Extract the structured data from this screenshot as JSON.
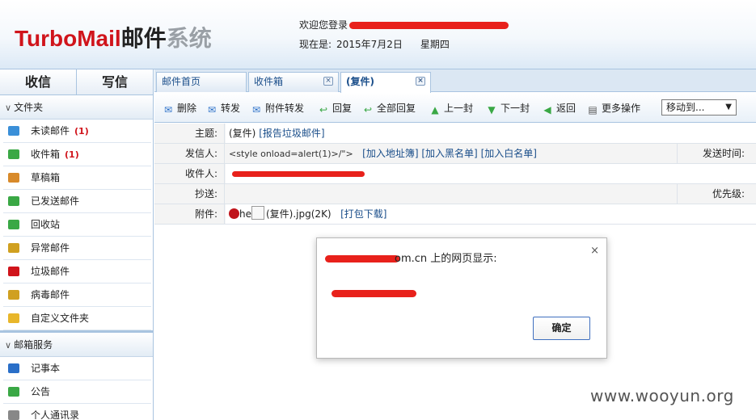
{
  "header": {
    "logo_brand": "TurboMail",
    "logo_mail": "邮件",
    "logo_system": "系统",
    "welcome_text": "欢迎您登录",
    "date_label": "现在是:",
    "date_value": "2015年7月2日",
    "weekday": "星期四"
  },
  "sidebar": {
    "inbox_button": "收信",
    "compose_button": "写信",
    "folders_header": "文件夹",
    "folders": [
      {
        "label": "未读邮件",
        "count": "(1)",
        "icon": "unread-mail-icon",
        "color": "#3a8fd8"
      },
      {
        "label": "收件箱",
        "count": "(1)",
        "icon": "inbox-icon",
        "color": "#3aa845"
      },
      {
        "label": "草稿箱",
        "count": "",
        "icon": "drafts-icon",
        "color": "#d88a2a"
      },
      {
        "label": "已发送邮件",
        "count": "",
        "icon": "sent-mail-icon",
        "color": "#3aa845"
      },
      {
        "label": "回收站",
        "count": "",
        "icon": "recycle-bin-icon",
        "color": "#3aa845"
      },
      {
        "label": "异常邮件",
        "count": "",
        "icon": "abnormal-mail-icon",
        "color": "#d0a020"
      },
      {
        "label": "垃圾邮件",
        "count": "",
        "icon": "spam-icon",
        "color": "#d0141b"
      },
      {
        "label": "病毒邮件",
        "count": "",
        "icon": "virus-mail-icon",
        "color": "#d0a020"
      },
      {
        "label": "自定义文件夹",
        "count": "",
        "icon": "custom-folder-icon",
        "color": "#e8b62a"
      }
    ],
    "services_header": "邮箱服务",
    "services": [
      {
        "label": "记事本",
        "icon": "notepad-icon",
        "color": "#2a6fc8"
      },
      {
        "label": "公告",
        "icon": "announcement-icon",
        "color": "#3aa845"
      },
      {
        "label": "个人通讯录",
        "icon": "address-book-icon",
        "color": "#888888"
      }
    ]
  },
  "tabs": [
    {
      "label": "邮件首页",
      "closable": false
    },
    {
      "label": "收件箱",
      "closable": true
    },
    {
      "label": "(复件)",
      "closable": true,
      "active": true
    }
  ],
  "toolbar": {
    "delete": "删除",
    "forward": "转发",
    "forward_attachment": "附件转发",
    "reply": "回复",
    "reply_all": "全部回复",
    "previous": "上一封",
    "next": "下一封",
    "back": "返回",
    "more": "更多操作",
    "move_to": "移动到..."
  },
  "mail": {
    "subject_label": "主题:",
    "subject_value": "(复件)",
    "report_spam": "[报告垃圾邮件]",
    "from_label": "发信人:",
    "from_value": "<style onload=alert(1)>/\">",
    "add_address_book": "[加入地址簿]",
    "add_blacklist": "[加入黑名单]",
    "add_whitelist": "[加入白名单]",
    "send_time_label": "发送时间:",
    "to_label": "收件人:",
    "cc_label": "抄送:",
    "priority_label": "优先级:",
    "attachment_label": "附件:",
    "attachment_prefix": "he",
    "attachment_name": "(复件).jpg(2K)",
    "download_pack": "[打包下载]"
  },
  "dialog": {
    "title_suffix": "om.cn 上的网页显示:",
    "ok_button": "确定",
    "close_symbol": "×"
  },
  "watermark": "www.wooyun.org"
}
